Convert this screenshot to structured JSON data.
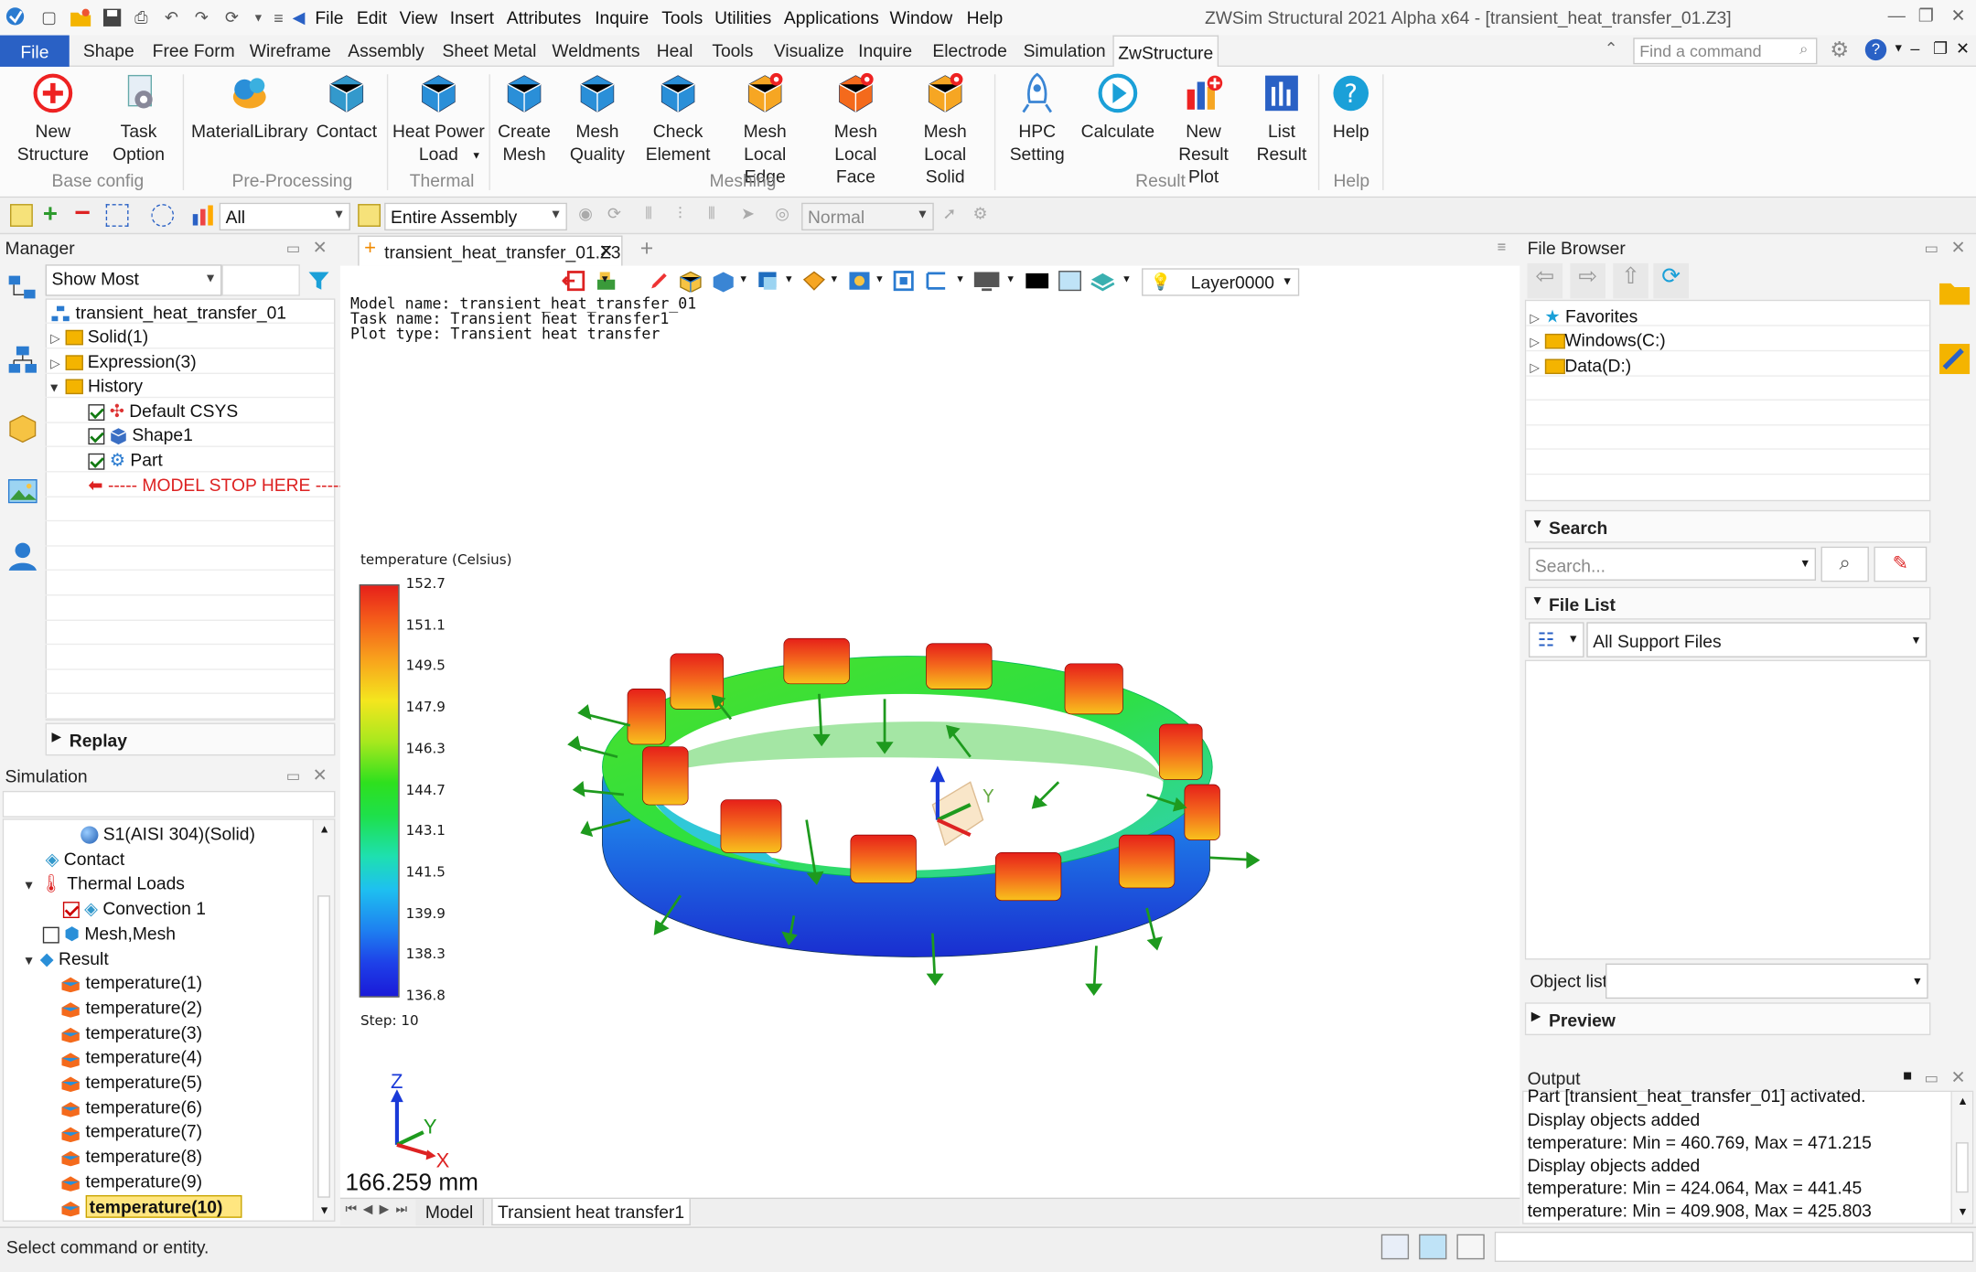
{
  "window": {
    "title": "ZWSim Structural 2021 Alpha  x64 - [transient_heat_transfer_01.Z3]"
  },
  "menu": [
    "File",
    "Edit",
    "View",
    "Insert",
    "Attributes",
    "Inquire",
    "Tools",
    "Utilities",
    "Applications",
    "Window",
    "Help"
  ],
  "ribbon_tabs": [
    "File",
    "Shape",
    "Free Form",
    "Wireframe",
    "Assembly",
    "Sheet Metal",
    "Weldments",
    "Heal",
    "Tools",
    "Visualize",
    "Inquire",
    "Electrode",
    "Simulation",
    "ZwStructure"
  ],
  "active_tab": "ZwStructure",
  "command_search": {
    "placeholder": "Find a command"
  },
  "ribbon": {
    "buttons": [
      {
        "l1": "New",
        "l2": "Structure",
        "icon": "plus-circle-icon"
      },
      {
        "l1": "Task",
        "l2": "Option",
        "icon": "task-option-icon"
      },
      {
        "l1": "MaterialLibrary",
        "l2": "",
        "icon": "material-library-icon"
      },
      {
        "l1": "Contact",
        "l2": "",
        "icon": "contact-icon"
      },
      {
        "l1": "Heat Power",
        "l2": "Load",
        "icon": "heat-power-load-icon"
      },
      {
        "l1": "Create",
        "l2": "Mesh",
        "icon": "create-mesh-icon"
      },
      {
        "l1": "Mesh",
        "l2": "Quality",
        "icon": "mesh-quality-icon"
      },
      {
        "l1": "Check",
        "l2": "Element",
        "icon": "check-element-icon"
      },
      {
        "l1": "Mesh Local",
        "l2": "Edge",
        "icon": "mesh-local-edge-icon"
      },
      {
        "l1": "Mesh Local",
        "l2": "Face",
        "icon": "mesh-local-face-icon"
      },
      {
        "l1": "Mesh Local",
        "l2": "Solid",
        "icon": "mesh-local-solid-icon"
      },
      {
        "l1": "HPC",
        "l2": "Setting",
        "icon": "hpc-setting-icon"
      },
      {
        "l1": "Calculate",
        "l2": "",
        "icon": "calculate-icon"
      },
      {
        "l1": "New Result",
        "l2": "Plot",
        "icon": "new-result-plot-icon"
      },
      {
        "l1": "List",
        "l2": "Result",
        "icon": "list-result-icon"
      },
      {
        "l1": "Help",
        "l2": "",
        "icon": "help-icon"
      }
    ],
    "groups": [
      "Base config",
      "Pre-Processing",
      "Thermal",
      "Meshing",
      "Result",
      "Help"
    ]
  },
  "toolbar2": {
    "filter": "All",
    "assembly": "Entire Assembly",
    "mode": "Normal"
  },
  "manager": {
    "title": "Manager",
    "filter": "Show Most",
    "tree": [
      "transient_heat_transfer_01",
      "Solid(1)",
      "Expression(3)",
      "History",
      "Default CSYS",
      "Shape1",
      "Part",
      "----- MODEL STOP HERE -----"
    ],
    "replay": "Replay"
  },
  "simulation": {
    "title": "Simulation",
    "items": [
      "S1(AISI 304)(Solid)",
      "Contact",
      "Thermal Loads",
      "Convection 1",
      "Mesh,Mesh",
      "Result",
      "temperature(1)",
      "temperature(2)",
      "temperature(3)",
      "temperature(4)",
      "temperature(5)",
      "temperature(6)",
      "temperature(7)",
      "temperature(8)",
      "temperature(9)",
      "temperature(10)"
    ]
  },
  "document": {
    "tab": "transient_heat_transfer_01.Z3",
    "layer": "Layer0000"
  },
  "viewport": {
    "info": [
      "Model name: transient_heat_transfer_01",
      "Task name: Transient heat transfer1",
      "Plot type: Transient heat transfer"
    ],
    "legend_title": "temperature (Celsius)",
    "legend_values": [
      "152.7",
      "151.1",
      "149.5",
      "147.9",
      "146.3",
      "144.7",
      "143.1",
      "141.5",
      "139.9",
      "138.3",
      "136.8"
    ],
    "step": "Step: 10",
    "scale": "166.259 mm",
    "axis_z": "Z",
    "axis_y": "Y",
    "axis_x": "X",
    "triad_y": "Y"
  },
  "bottom_tabs": [
    "Model",
    "Transient heat transfer1"
  ],
  "file_browser": {
    "title": "File Browser",
    "items": [
      "Favorites",
      "Windows(C:)",
      "Data(D:)"
    ],
    "search_title": "Search",
    "search_placeholder": "Search...",
    "file_list_title": "File List",
    "file_filter": "All Support Files",
    "object_list": "Object list",
    "preview": "Preview"
  },
  "output": {
    "title": "Output",
    "lines": [
      "Part [transient_heat_transfer_01] activated.",
      "Display objects added",
      "temperature: Min = 460.769, Max = 471.215",
      "Display objects added",
      "temperature: Min = 424.064, Max = 441.45",
      "temperature: Min = 409.908, Max = 425.803"
    ]
  },
  "status": {
    "text": "Select command or entity."
  },
  "colors": {
    "file_tab": "#2a61c5",
    "heat_red": "#e03020",
    "arrow_green": "#1e9a1e"
  }
}
